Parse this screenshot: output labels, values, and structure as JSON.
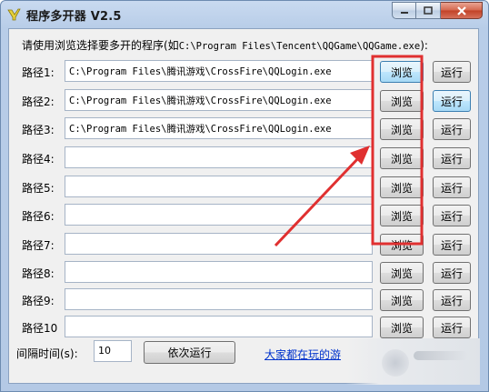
{
  "window": {
    "title": "程序多开器 V2.5",
    "app_icon": "app-logo-icon",
    "controls": [
      "minimize-icon",
      "maximize-icon",
      "close-icon"
    ]
  },
  "instruction": {
    "prefix": "请使用浏览选择要多开的程序(如",
    "example_path": "C:\\Program Files\\Tencent\\QQGame\\QQGame.exe",
    "suffix": "):"
  },
  "rows": [
    {
      "label": "路径1:",
      "value": "C:\\Program Files\\腾讯游戏\\CrossFire\\QQLogin.exe",
      "browse": "浏览",
      "run": "运行"
    },
    {
      "label": "路径2:",
      "value": "C:\\Program Files\\腾讯游戏\\CrossFire\\QQLogin.exe",
      "browse": "浏览",
      "run": "运行"
    },
    {
      "label": "路径3:",
      "value": "C:\\Program Files\\腾讯游戏\\CrossFire\\QQLogin.exe",
      "browse": "浏览",
      "run": "运行"
    },
    {
      "label": "路径4:",
      "value": "",
      "browse": "浏览",
      "run": "运行"
    },
    {
      "label": "路径5:",
      "value": "",
      "browse": "浏览",
      "run": "运行"
    },
    {
      "label": "路径6:",
      "value": "",
      "browse": "浏览",
      "run": "运行"
    },
    {
      "label": "路径7:",
      "value": "",
      "browse": "浏览",
      "run": "运行"
    },
    {
      "label": "路径8:",
      "value": "",
      "browse": "浏览",
      "run": "运行"
    },
    {
      "label": "路径9:",
      "value": "",
      "browse": "浏览",
      "run": "运行"
    },
    {
      "label": "路径10",
      "value": "",
      "browse": "浏览",
      "run": "运行"
    }
  ],
  "interval": {
    "label": "间隔时间(s):",
    "value": "10"
  },
  "run_all_label": "依次运行",
  "link_text": "大家都在玩的游",
  "colors": {
    "annotation_red": "#e03030",
    "link_blue": "#0033cc"
  }
}
